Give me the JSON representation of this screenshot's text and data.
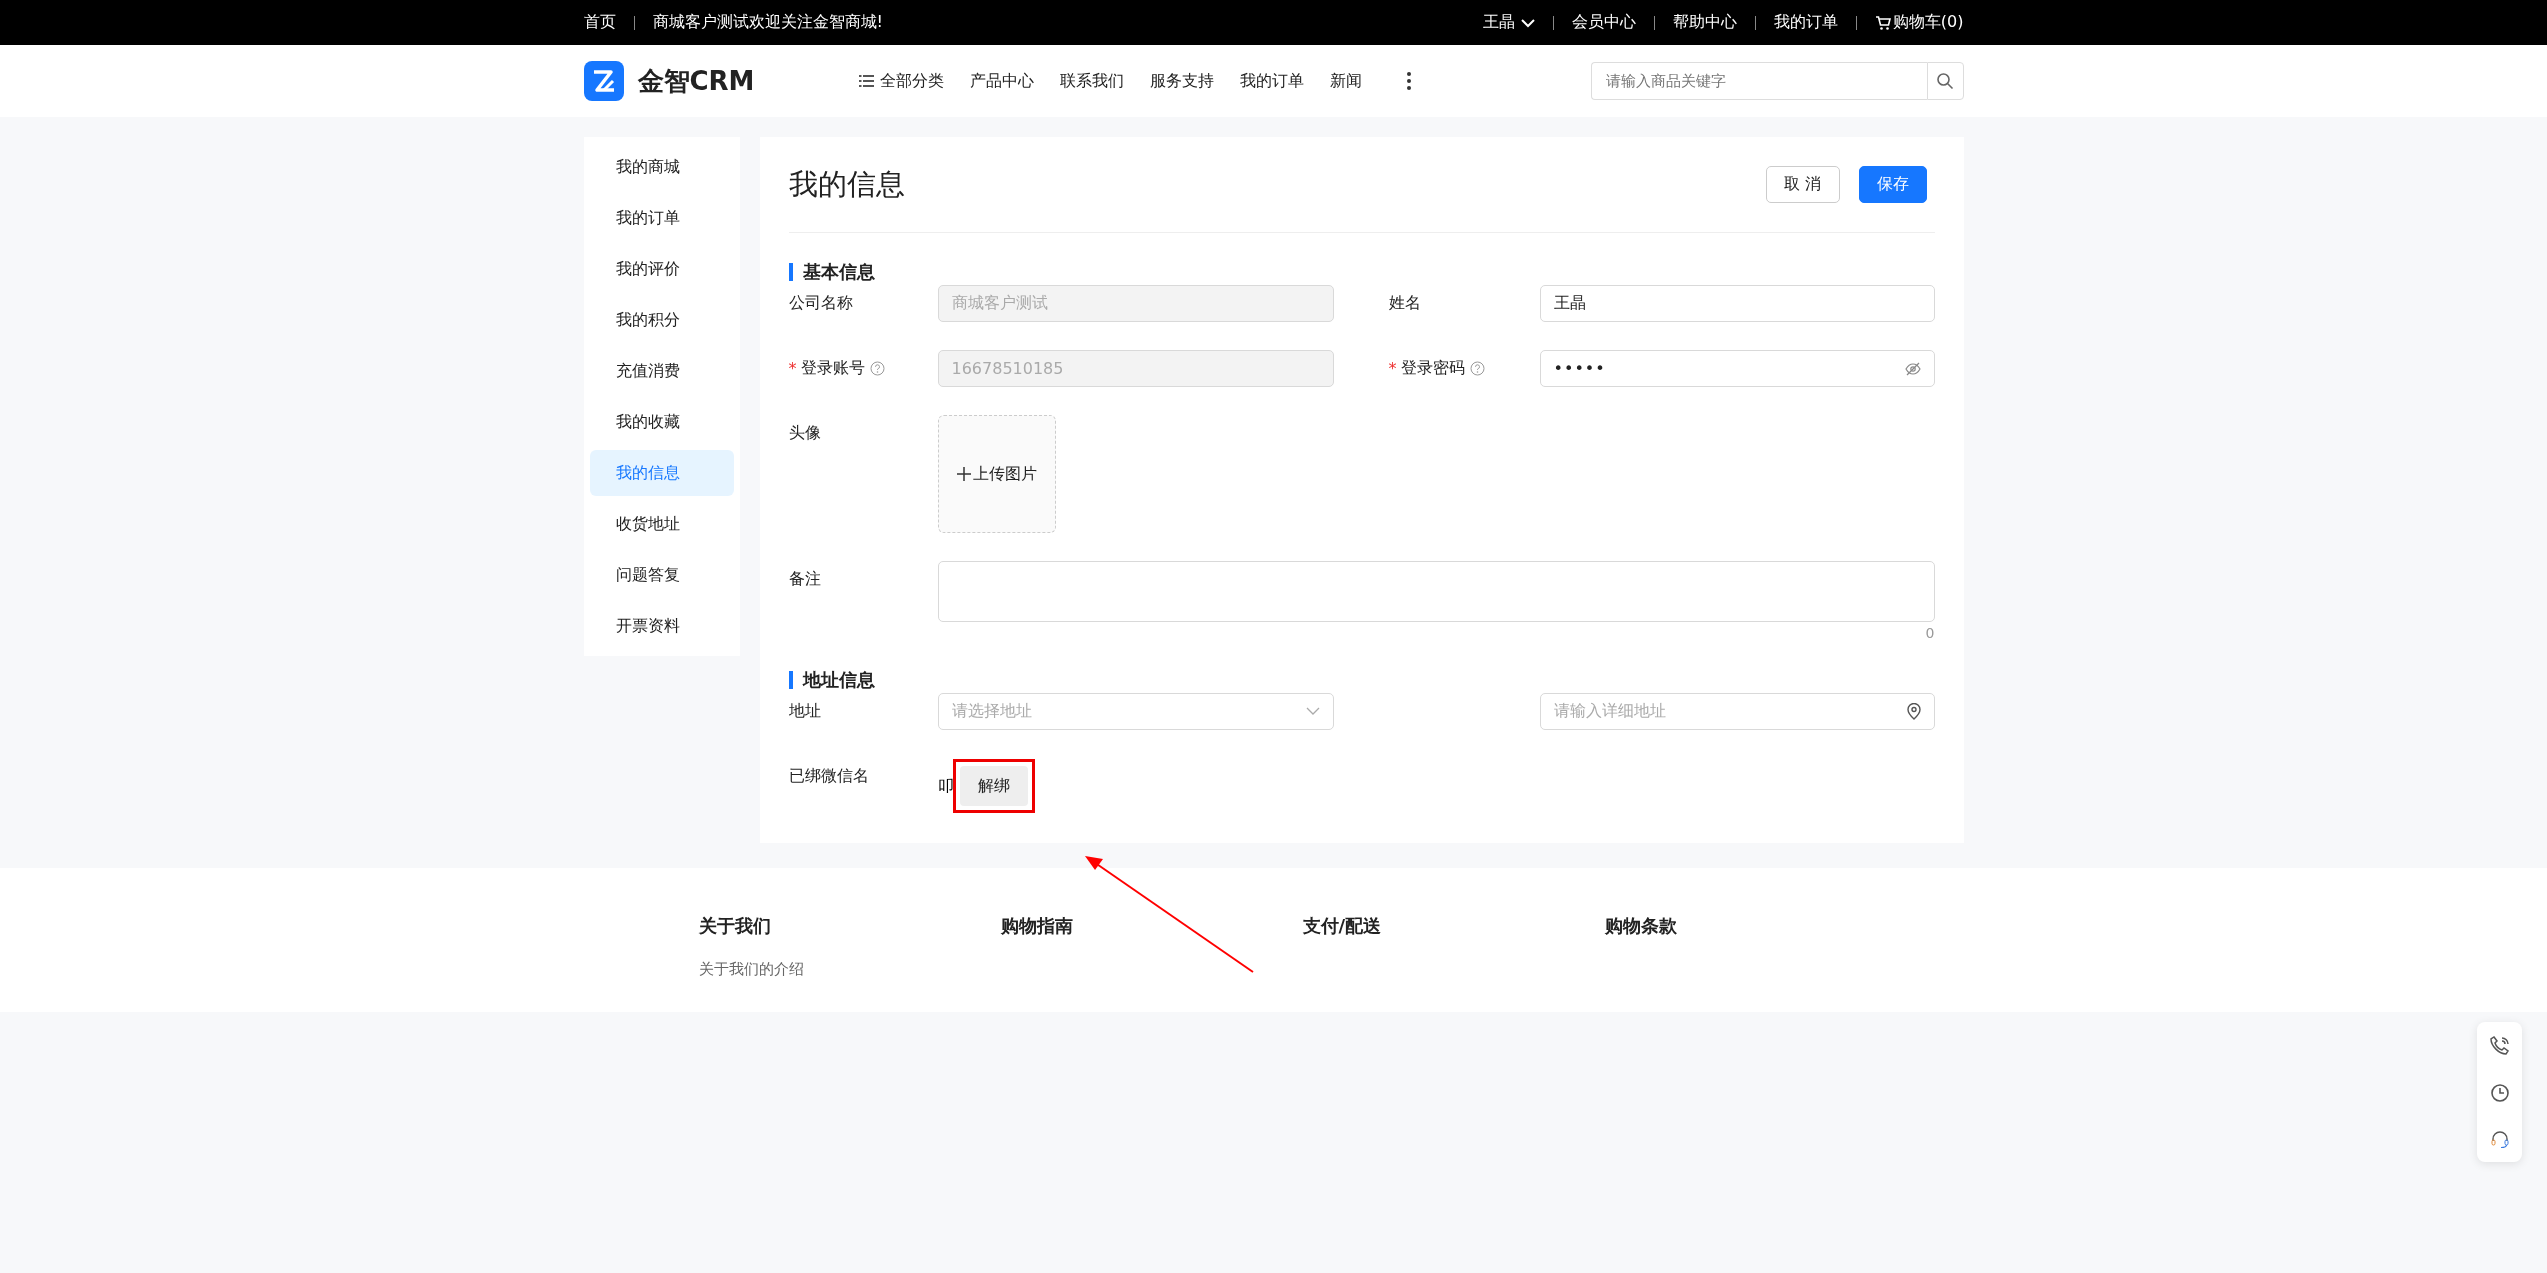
{
  "top_bar": {
    "left": [
      "首页",
      "商城客户测试欢迎关注金智商城!"
    ],
    "user": "王晶",
    "right": [
      "会员中心",
      "帮助中心",
      "我的订单"
    ],
    "cart": "购物车(0)"
  },
  "header": {
    "logo": "金智CRM",
    "nav": [
      {
        "label": "全部分类",
        "kind": "category"
      },
      {
        "label": "产品中心",
        "kind": "link"
      },
      {
        "label": "联系我们",
        "kind": "link"
      },
      {
        "label": "服务支持",
        "kind": "link"
      },
      {
        "label": "我的订单",
        "kind": "link"
      },
      {
        "label": "新闻",
        "kind": "link"
      }
    ],
    "search": {
      "placeholder": "请输入商品关键字"
    }
  },
  "sidebar": {
    "items": [
      {
        "label": "我的商城",
        "selected": false
      },
      {
        "label": "我的订单",
        "selected": false
      },
      {
        "label": "我的评价",
        "selected": false
      },
      {
        "label": "我的积分",
        "selected": false
      },
      {
        "label": "充值消费",
        "selected": false
      },
      {
        "label": "我的收藏",
        "selected": false
      },
      {
        "label": "我的信息",
        "selected": true
      },
      {
        "label": "收货地址",
        "selected": false
      },
      {
        "label": "问题答复",
        "selected": false
      },
      {
        "label": "开票资料",
        "selected": false
      }
    ]
  },
  "page": {
    "title": "我的信息",
    "buttons": [
      {
        "label": "取 消",
        "kind": "secondary"
      },
      {
        "label": "保存",
        "kind": "primary"
      }
    ]
  },
  "sections": [
    {
      "title": "基本信息",
      "rows": [
        [
          {
            "label": "公司名称",
            "kind": "text",
            "value": "商城客户测试",
            "disabled": true
          },
          {
            "label": "姓名",
            "kind": "text",
            "value": "王晶",
            "disabled": false
          }
        ],
        [
          {
            "label": "登录账号",
            "kind": "text",
            "value": "16678510185",
            "disabled": true,
            "required": "*",
            "help": true
          },
          {
            "label": "登录密码",
            "kind": "password",
            "value": "•••••",
            "required": "*",
            "help": true
          }
        ],
        [
          {
            "label": "头像",
            "kind": "upload",
            "text": "上传图片"
          }
        ],
        [
          {
            "label": "备注",
            "kind": "textarea",
            "count": "0"
          }
        ]
      ]
    },
    {
      "title": "地址信息",
      "rows": [
        [
          {
            "label": "地址",
            "kind": "select",
            "placeholder": "请选择地址"
          },
          {
            "kind": "location",
            "placeholder": "请输入详细地址"
          }
        ],
        [
          {
            "label": "已绑微信名",
            "kind": "wechat",
            "value": "叩",
            "button": "解绑",
            "highlighted": true
          }
        ]
      ]
    }
  ],
  "footer": {
    "columns": [
      {
        "title": "关于我们",
        "links": [
          "关于我们的介绍"
        ]
      },
      {
        "title": "购物指南"
      },
      {
        "title": "支付/配送"
      },
      {
        "title": "购物条款"
      }
    ]
  }
}
